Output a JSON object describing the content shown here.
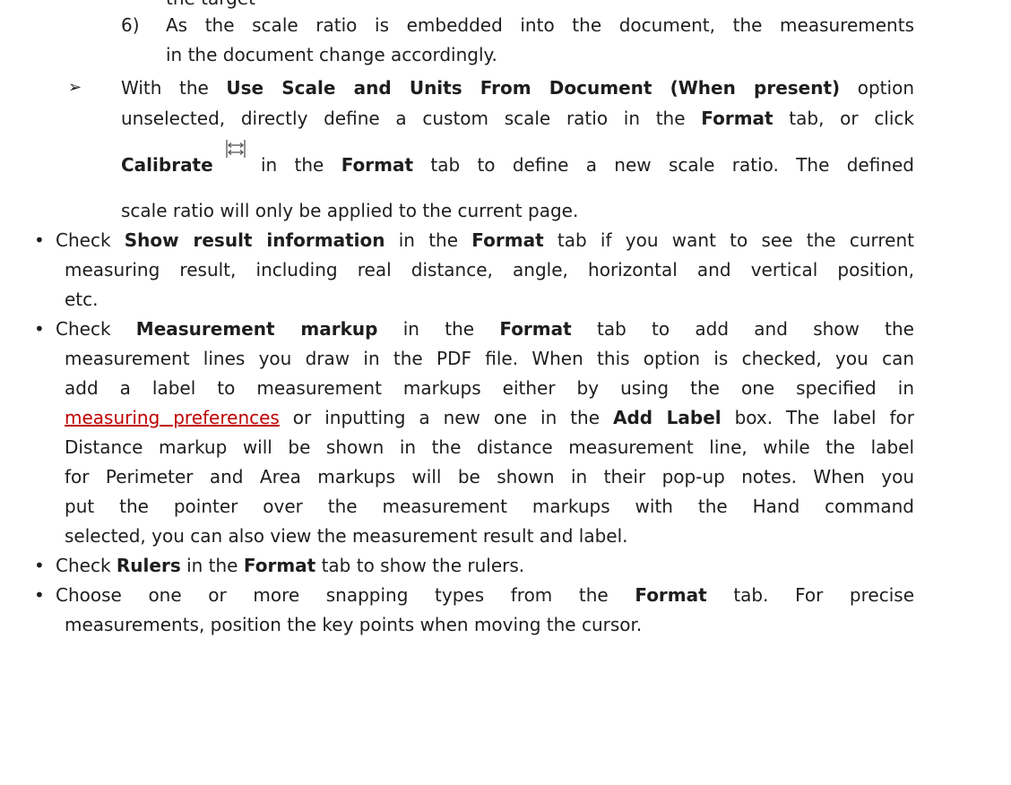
{
  "fragment_top": "the target",
  "num_item": {
    "number": "6)",
    "line1": "As the scale ratio is embedded into the document, the measurements",
    "line2": "in the document change accordingly."
  },
  "arrow_item": {
    "marker": "➢",
    "l1_a": "With the ",
    "l1_b": "Use Scale and Units From Document (When present)",
    "l1_c": " option",
    "l2_a": "unselected, directly define a custom scale ratio in the ",
    "l2_b": "Format",
    "l2_c": " tab, or click",
    "l3_a": "Calibrate",
    "l3_c": " in the ",
    "l3_d": "Format",
    "l3_e": " tab to define a new scale ratio. The defined",
    "l4": "scale ratio will only be applied to the current page."
  },
  "bullets": {
    "marker": "•",
    "b1": {
      "l1_a": "Check ",
      "l1_b": "Show result information",
      "l1_c": " in the ",
      "l1_d": "Format",
      "l1_e": " tab if you want to see the current",
      "l2": "measuring result, including real distance, angle, horizontal and vertical position,",
      "l3": "etc."
    },
    "b2": {
      "l1_a": "Check ",
      "l1_b": "Measurement markup",
      "l1_c": " in the ",
      "l1_d": "Format",
      "l1_e": " tab to add and show the",
      "l2": "measurement lines you draw in the PDF file. When this option is checked, you can",
      "l3": "add a label to measurement markups either by using the one specified in",
      "l4_link": "measuring preferences",
      "l4_b": " or inputting a new one in the ",
      "l4_c": "Add Label",
      "l4_d": " box. The label for",
      "l5": "Distance markup will be shown in the distance measurement line, while the label",
      "l6": "for Perimeter and Area markups will be shown in their pop-up notes. When you",
      "l7": "put the pointer over the measurement markups with the Hand command",
      "l8": "selected, you can also view the measurement result and label."
    },
    "b3": {
      "l1_a": "Check ",
      "l1_b": "Rulers",
      "l1_c": " in the ",
      "l1_d": "Format",
      "l1_e": " tab to show the rulers."
    },
    "b4": {
      "l1_a": "Choose one or more snapping types from the ",
      "l1_b": "Format",
      "l1_c": " tab. For precise",
      "l2": "measurements, position the key points when moving the cursor."
    }
  },
  "icons": {
    "calibrate": "calibrate-icon"
  },
  "colors": {
    "text": "#1e1e1e",
    "link": "#c00000"
  }
}
